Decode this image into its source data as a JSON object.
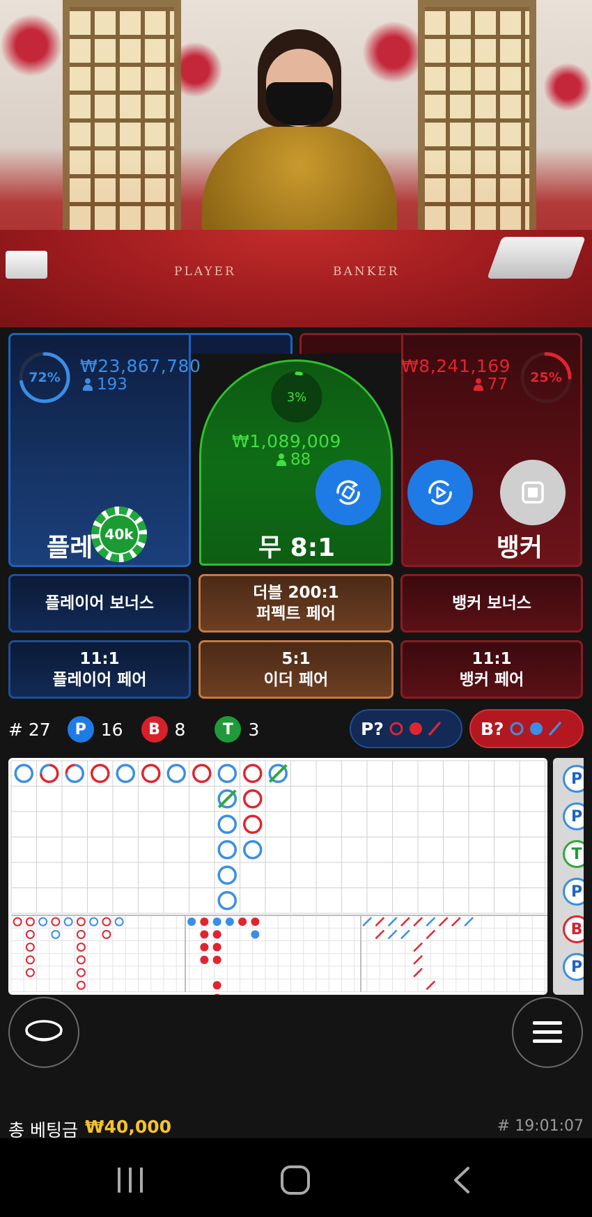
{
  "table": {
    "player_text": "PLAYER",
    "banker_text": "BANKER"
  },
  "player": {
    "percent": "72%",
    "percent_value": 0.72,
    "amount": "₩23,867,780",
    "count": "193",
    "label": "플레이어",
    "label_visible": "플레",
    "chip": "40k"
  },
  "tie": {
    "percent": "3%",
    "percent_value": 0.03,
    "amount": "₩1,089,009",
    "count": "88",
    "label": "무 8:1"
  },
  "banker": {
    "percent": "25%",
    "percent_value": 0.25,
    "amount": "₩8,241,169",
    "count": "77",
    "label": "뱅커"
  },
  "controls": {
    "repeat_icon": "repeat-icon",
    "play_icon": "play-icon",
    "stop_icon": "stop-icon"
  },
  "side_bets": {
    "player_bonus": "플레이어 보너스",
    "perfect_pair_line1": "더블 200:1",
    "perfect_pair_line2": "퍼펙트 페어",
    "banker_bonus": "뱅커 보너스",
    "player_pair_line1": "11:1",
    "player_pair_line2": "플레이어 페어",
    "either_pair_line1": "5:1",
    "either_pair_line2": "이더 페어",
    "banker_pair_line1": "11:1",
    "banker_pair_line2": "뱅커 페어"
  },
  "stats": {
    "round": "# 27",
    "p_badge": "P",
    "p_count": "16",
    "b_badge": "B",
    "b_count": "8",
    "t_badge": "T",
    "t_count": "3"
  },
  "predict": {
    "player": "P?",
    "banker": "B?"
  },
  "colors": {
    "player_blue": "#3a8ee6",
    "banker_red": "#e0252f",
    "tie_green": "#2ea83a"
  },
  "bead_road": {
    "columns": [
      [
        "P"
      ],
      [
        "B"
      ],
      [
        "P"
      ],
      [
        "B"
      ],
      [
        "P"
      ],
      [
        "B"
      ],
      [
        "P"
      ],
      [
        "B"
      ],
      [
        "P",
        "P",
        "P",
        "P",
        "P",
        "P"
      ],
      [
        "B",
        "B",
        "B",
        "P"
      ],
      [
        "T"
      ]
    ],
    "extras": {
      "tie_marks": [
        [
          0,
          1
        ],
        [
          8,
          1
        ],
        [
          10,
          0
        ]
      ],
      "half_marks": [
        [
          1,
          0
        ],
        [
          2,
          0
        ],
        [
          0,
          2
        ],
        [
          7,
          1
        ]
      ]
    }
  },
  "side_strip": [
    "P",
    "P",
    "T",
    "P",
    "B",
    "P"
  ],
  "bottom": {
    "total_label": "총 베팅금",
    "total_amount": "₩40,000",
    "time": "# 19:01:07"
  }
}
